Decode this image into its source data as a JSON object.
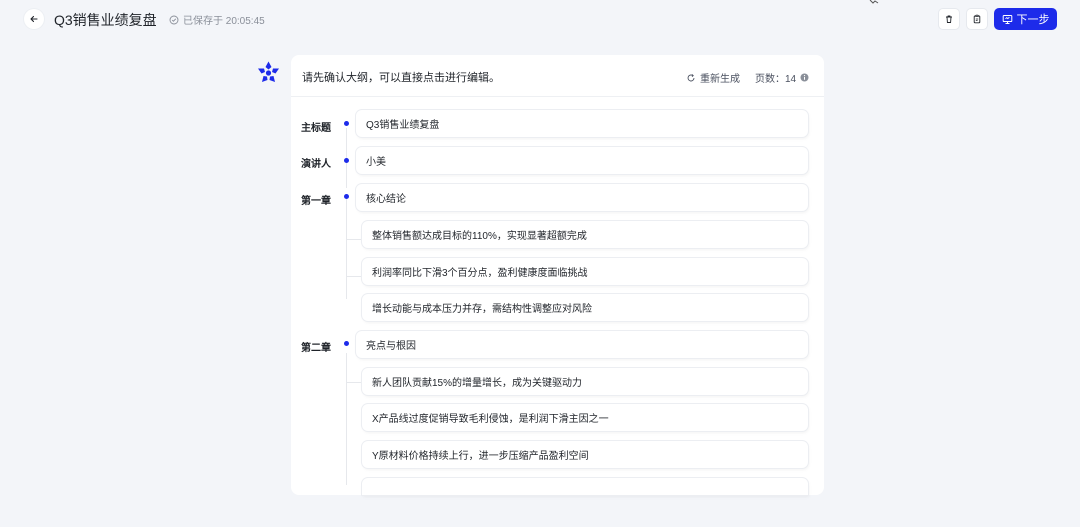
{
  "header": {
    "title": "Q3销售业绩复盘",
    "saved_text": "已保存于 20:05:45",
    "next_label": "下一步"
  },
  "outline": {
    "prompt": "请先确认大纲，可以直接点击进行编辑。",
    "regenerate_label": "重新生成",
    "pages_label": "页数：14",
    "main_title_label": "主标题",
    "main_title_value": "Q3销售业绩复盘",
    "speaker_label": "演讲人",
    "speaker_value": "小美",
    "chapters": [
      {
        "label": "第一章",
        "title": "核心结论",
        "points": [
          "整体销售额达成目标的110%，实现显著超额完成",
          "利润率同比下滑3个百分点，盈利健康度面临挑战",
          "增长动能与成本压力并存，需结构性调整应对风险"
        ]
      },
      {
        "label": "第二章",
        "title": "亮点与根因",
        "points": [
          "新人团队贡献15%的增量增长，成为关键驱动力",
          "X产品线过度促销导致毛利侵蚀，是利润下滑主因之一",
          "Y原材料价格持续上行，进一步压缩产品盈利空间"
        ]
      }
    ]
  },
  "colors": {
    "accent": "#1d2bea",
    "background": "#f3f5f9",
    "card": "#ffffff"
  },
  "icons": [
    "back-arrow-icon",
    "check-circle-icon",
    "trash-icon",
    "clipboard-icon",
    "presentation-icon",
    "refresh-icon",
    "info-icon",
    "app-logo"
  ]
}
